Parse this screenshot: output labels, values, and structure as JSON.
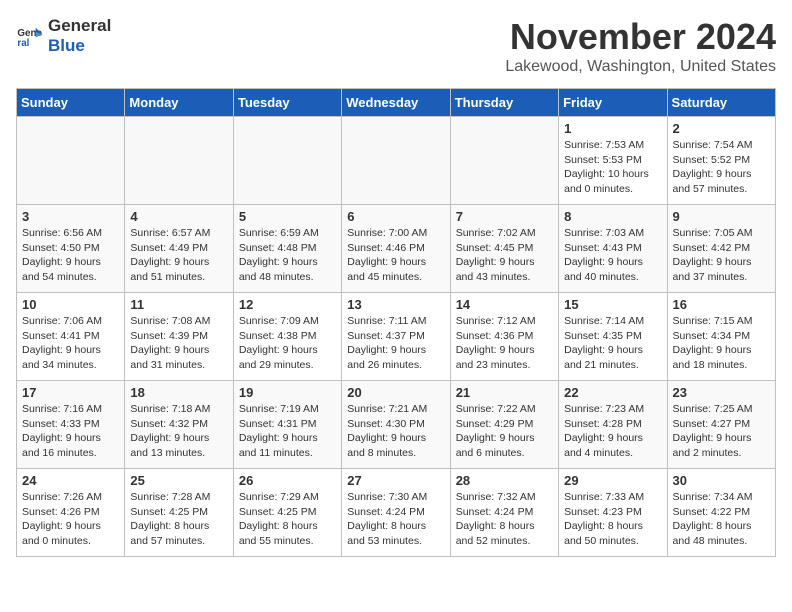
{
  "logo": {
    "line1": "General",
    "line2": "Blue"
  },
  "title": "November 2024",
  "subtitle": "Lakewood, Washington, United States",
  "weekdays": [
    "Sunday",
    "Monday",
    "Tuesday",
    "Wednesday",
    "Thursday",
    "Friday",
    "Saturday"
  ],
  "weeks": [
    [
      {
        "day": "",
        "info": ""
      },
      {
        "day": "",
        "info": ""
      },
      {
        "day": "",
        "info": ""
      },
      {
        "day": "",
        "info": ""
      },
      {
        "day": "",
        "info": ""
      },
      {
        "day": "1",
        "info": "Sunrise: 7:53 AM\nSunset: 5:53 PM\nDaylight: 10 hours\nand 0 minutes."
      },
      {
        "day": "2",
        "info": "Sunrise: 7:54 AM\nSunset: 5:52 PM\nDaylight: 9 hours\nand 57 minutes."
      }
    ],
    [
      {
        "day": "3",
        "info": "Sunrise: 6:56 AM\nSunset: 4:50 PM\nDaylight: 9 hours\nand 54 minutes."
      },
      {
        "day": "4",
        "info": "Sunrise: 6:57 AM\nSunset: 4:49 PM\nDaylight: 9 hours\nand 51 minutes."
      },
      {
        "day": "5",
        "info": "Sunrise: 6:59 AM\nSunset: 4:48 PM\nDaylight: 9 hours\nand 48 minutes."
      },
      {
        "day": "6",
        "info": "Sunrise: 7:00 AM\nSunset: 4:46 PM\nDaylight: 9 hours\nand 45 minutes."
      },
      {
        "day": "7",
        "info": "Sunrise: 7:02 AM\nSunset: 4:45 PM\nDaylight: 9 hours\nand 43 minutes."
      },
      {
        "day": "8",
        "info": "Sunrise: 7:03 AM\nSunset: 4:43 PM\nDaylight: 9 hours\nand 40 minutes."
      },
      {
        "day": "9",
        "info": "Sunrise: 7:05 AM\nSunset: 4:42 PM\nDaylight: 9 hours\nand 37 minutes."
      }
    ],
    [
      {
        "day": "10",
        "info": "Sunrise: 7:06 AM\nSunset: 4:41 PM\nDaylight: 9 hours\nand 34 minutes."
      },
      {
        "day": "11",
        "info": "Sunrise: 7:08 AM\nSunset: 4:39 PM\nDaylight: 9 hours\nand 31 minutes."
      },
      {
        "day": "12",
        "info": "Sunrise: 7:09 AM\nSunset: 4:38 PM\nDaylight: 9 hours\nand 29 minutes."
      },
      {
        "day": "13",
        "info": "Sunrise: 7:11 AM\nSunset: 4:37 PM\nDaylight: 9 hours\nand 26 minutes."
      },
      {
        "day": "14",
        "info": "Sunrise: 7:12 AM\nSunset: 4:36 PM\nDaylight: 9 hours\nand 23 minutes."
      },
      {
        "day": "15",
        "info": "Sunrise: 7:14 AM\nSunset: 4:35 PM\nDaylight: 9 hours\nand 21 minutes."
      },
      {
        "day": "16",
        "info": "Sunrise: 7:15 AM\nSunset: 4:34 PM\nDaylight: 9 hours\nand 18 minutes."
      }
    ],
    [
      {
        "day": "17",
        "info": "Sunrise: 7:16 AM\nSunset: 4:33 PM\nDaylight: 9 hours\nand 16 minutes."
      },
      {
        "day": "18",
        "info": "Sunrise: 7:18 AM\nSunset: 4:32 PM\nDaylight: 9 hours\nand 13 minutes."
      },
      {
        "day": "19",
        "info": "Sunrise: 7:19 AM\nSunset: 4:31 PM\nDaylight: 9 hours\nand 11 minutes."
      },
      {
        "day": "20",
        "info": "Sunrise: 7:21 AM\nSunset: 4:30 PM\nDaylight: 9 hours\nand 8 minutes."
      },
      {
        "day": "21",
        "info": "Sunrise: 7:22 AM\nSunset: 4:29 PM\nDaylight: 9 hours\nand 6 minutes."
      },
      {
        "day": "22",
        "info": "Sunrise: 7:23 AM\nSunset: 4:28 PM\nDaylight: 9 hours\nand 4 minutes."
      },
      {
        "day": "23",
        "info": "Sunrise: 7:25 AM\nSunset: 4:27 PM\nDaylight: 9 hours\nand 2 minutes."
      }
    ],
    [
      {
        "day": "24",
        "info": "Sunrise: 7:26 AM\nSunset: 4:26 PM\nDaylight: 9 hours\nand 0 minutes."
      },
      {
        "day": "25",
        "info": "Sunrise: 7:28 AM\nSunset: 4:25 PM\nDaylight: 8 hours\nand 57 minutes."
      },
      {
        "day": "26",
        "info": "Sunrise: 7:29 AM\nSunset: 4:25 PM\nDaylight: 8 hours\nand 55 minutes."
      },
      {
        "day": "27",
        "info": "Sunrise: 7:30 AM\nSunset: 4:24 PM\nDaylight: 8 hours\nand 53 minutes."
      },
      {
        "day": "28",
        "info": "Sunrise: 7:32 AM\nSunset: 4:24 PM\nDaylight: 8 hours\nand 52 minutes."
      },
      {
        "day": "29",
        "info": "Sunrise: 7:33 AM\nSunset: 4:23 PM\nDaylight: 8 hours\nand 50 minutes."
      },
      {
        "day": "30",
        "info": "Sunrise: 7:34 AM\nSunset: 4:22 PM\nDaylight: 8 hours\nand 48 minutes."
      }
    ]
  ]
}
